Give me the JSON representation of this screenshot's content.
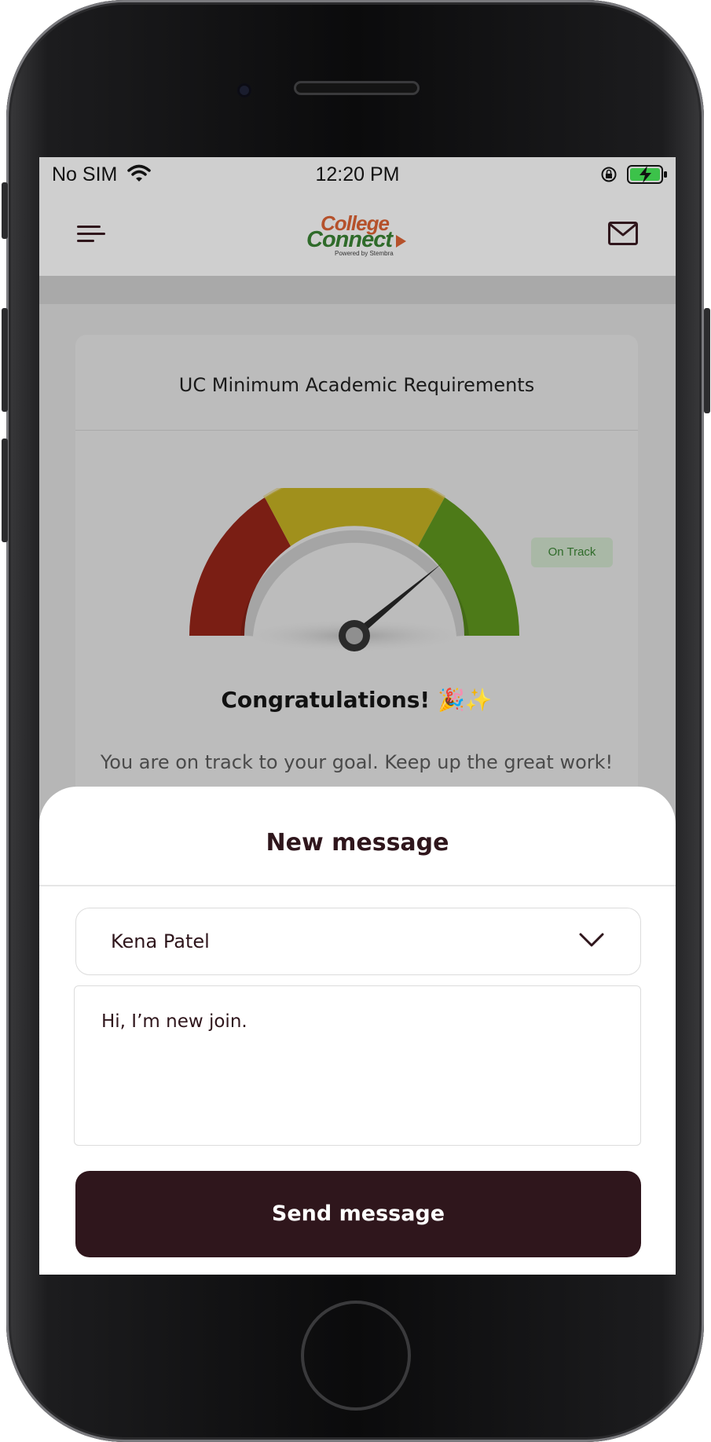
{
  "status_bar": {
    "carrier": "No SIM",
    "time": "12:20 PM"
  },
  "header": {
    "logo_line1": "College",
    "logo_line2": "Connect",
    "logo_tagline": "Powered by Stembra"
  },
  "card": {
    "title": "UC Minimum Academic Requirements",
    "gauge_level": 0.78,
    "status_badge": "On Track",
    "congrats": "Congratulations! 🎉✨",
    "message": "You are on track to your goal. Keep up the great work!"
  },
  "sheet": {
    "title": "New message",
    "recipient": "Kena Patel",
    "message_value": "Hi, I’m new join.",
    "send_label": "Send message"
  },
  "colors": {
    "primary": "#2f161c",
    "gauge_red": "#7a1e14",
    "gauge_yellow": "#a0901c",
    "gauge_green": "#4d7a18",
    "logo_orange": "#b5512b",
    "logo_green": "#2f6b2a"
  },
  "icons": [
    "menu-icon",
    "mail-icon",
    "wifi-icon",
    "lock-rotation-icon",
    "battery-charging-icon",
    "chevron-down-icon"
  ]
}
